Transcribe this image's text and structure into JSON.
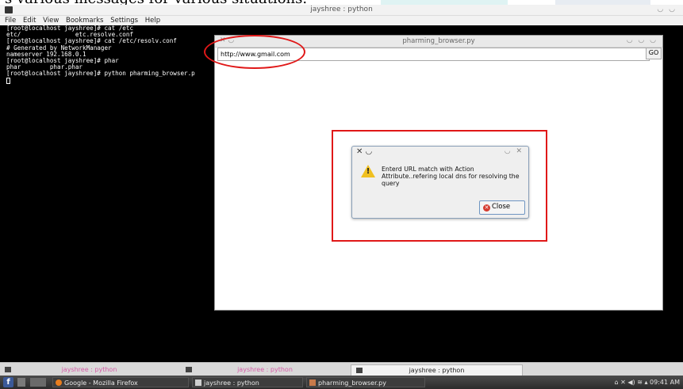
{
  "caption_partial": "s various messages for various situations.",
  "terminal": {
    "title": "jayshree : python",
    "menu": [
      "File",
      "Edit",
      "View",
      "Bookmarks",
      "Settings",
      "Help"
    ],
    "lines": [
      "[root@localhost jayshree]# cat /etc",
      "etc/               etc.resolve.conf",
      "[root@localhost jayshree]# cat /etc/resolv.conf",
      "# Generated by NetworkManager",
      "nameserver 192.168.0.1",
      "[root@localhost jayshree]# phar",
      "phar        phar.phar",
      "[root@localhost jayshree]# python pharming_browser.p"
    ]
  },
  "browser": {
    "title": "pharming_browser.py",
    "url_value": "http://www.gmail.com",
    "go_label": "GO"
  },
  "dialog": {
    "message": "Enterd URL match with Action Attribute..refering local dns for resolving the query",
    "close_label": "Close"
  },
  "tabs": [
    {
      "label": "jayshree : python",
      "state": "inactive"
    },
    {
      "label": "jayshree : python",
      "state": "inactive"
    },
    {
      "label": "jayshree : python",
      "state": "active"
    }
  ],
  "panel": {
    "tasks": [
      {
        "label": "Google - Mozilla Firefox"
      },
      {
        "label": "jayshree : python"
      },
      {
        "label": "pharming_browser.py"
      }
    ],
    "clock": "09:41 AM"
  },
  "colors": {
    "annotation_red": "#e01818",
    "terminal_bg": "#000000",
    "inactive_tab_text": "#d55ca6"
  }
}
